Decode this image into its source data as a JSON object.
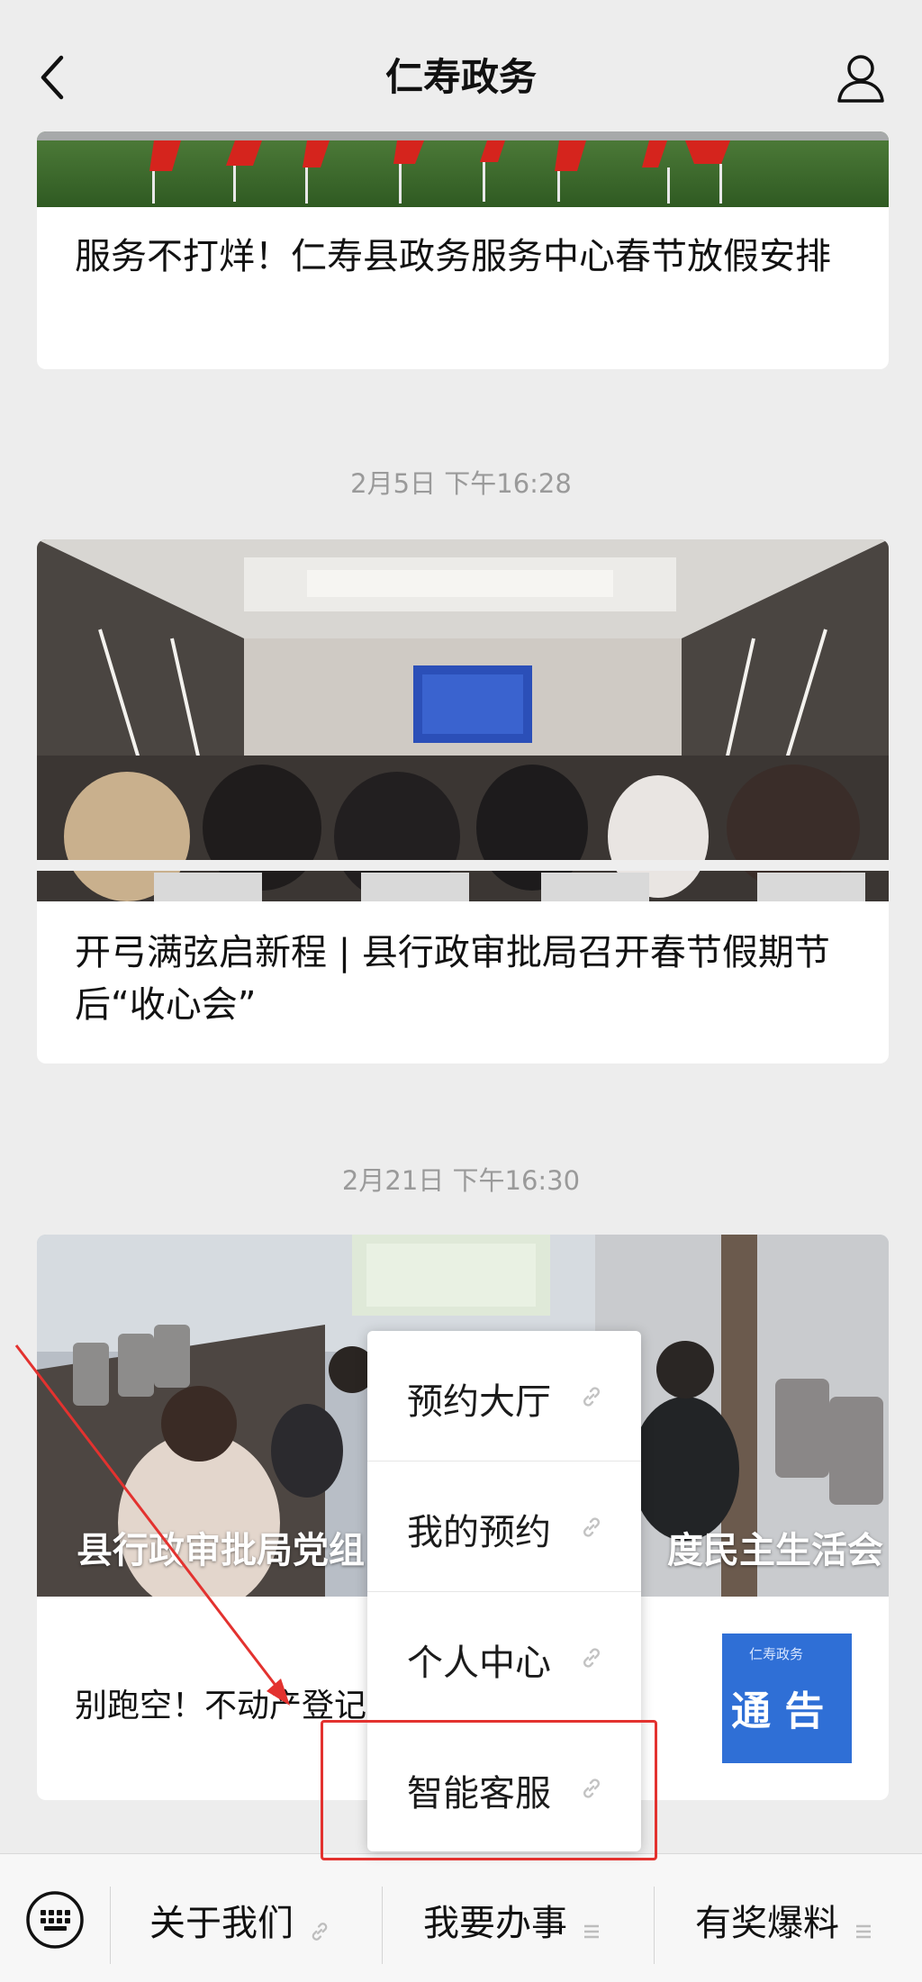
{
  "header": {
    "title": "仁寿政务",
    "back_icon": "chevron-left-icon",
    "user_icon": "user-icon"
  },
  "feed": {
    "article1": {
      "title": "服务不打烊！仁寿县政务服务中心春节放假安排"
    },
    "timestamp2": "2月5日 下午16:28",
    "article2": {
      "title": "开弓满弦启新程 | 县行政审批局召开春节假期节后“收心会”"
    },
    "timestamp3": "2月21日 下午16:30",
    "article3": {
      "overlay_left": "县行政审批局党组",
      "overlay_right": "度民主生活会",
      "sub_title": "别跑空！不动产登记",
      "thumb_text_small": "仁寿政务",
      "thumb_text_big": "通 告"
    }
  },
  "menu": {
    "items": [
      {
        "label": "预约大厅",
        "icon": "link-icon"
      },
      {
        "label": "我的预约",
        "icon": "link-icon"
      },
      {
        "label": "个人中心",
        "icon": "link-icon"
      },
      {
        "label": "智能客服",
        "icon": "link-icon"
      }
    ]
  },
  "bottom_bar": {
    "keyboard_icon": "keyboard-icon",
    "items": [
      {
        "label": "关于我们",
        "icon": "link-icon"
      },
      {
        "label": "我要办事",
        "icon": "menu-lines-icon"
      },
      {
        "label": "有奖爆料",
        "icon": "menu-lines-icon"
      }
    ]
  },
  "colors": {
    "background": "#ededed",
    "highlight": "#e3322f",
    "notice_blue": "#2f6fd6"
  }
}
